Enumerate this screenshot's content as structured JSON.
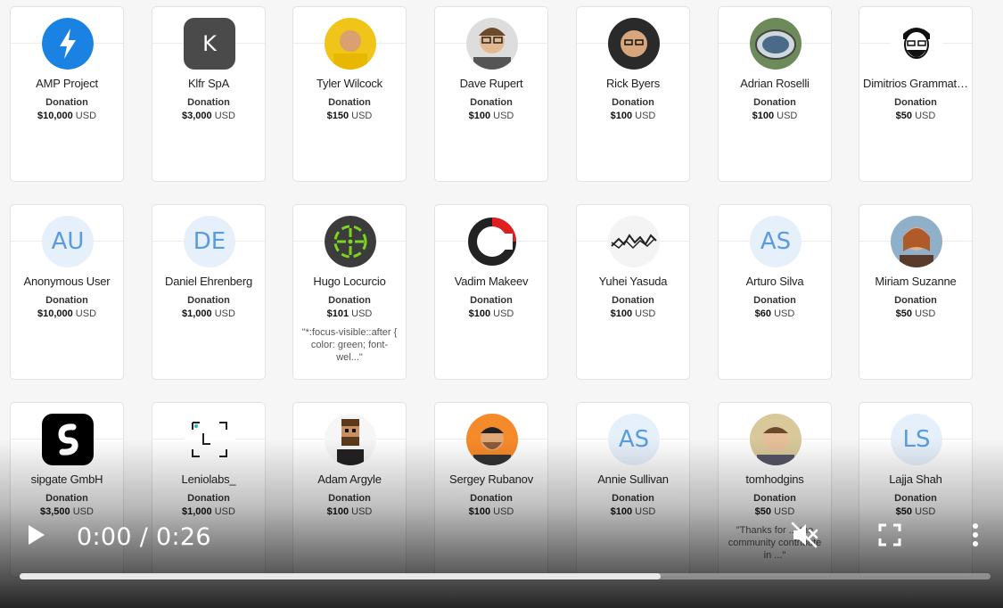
{
  "cards": [
    {
      "name": "AMP Project",
      "kind": "Donation",
      "amount": "$10,000",
      "currency": "USD",
      "avatar": "lightning-icon",
      "comment": ""
    },
    {
      "name": "Klfr SpA",
      "kind": "Donation",
      "amount": "$3,000",
      "currency": "USD",
      "avatar": "initial",
      "initials": "K",
      "comment": ""
    },
    {
      "name": "Tyler Wilcock",
      "kind": "Donation",
      "amount": "$150",
      "currency": "USD",
      "avatar": "photo",
      "comment": ""
    },
    {
      "name": "Dave Rupert",
      "kind": "Donation",
      "amount": "$100",
      "currency": "USD",
      "avatar": "photo",
      "comment": ""
    },
    {
      "name": "Rick Byers",
      "kind": "Donation",
      "amount": "$100",
      "currency": "USD",
      "avatar": "photo",
      "comment": ""
    },
    {
      "name": "Adrian Roselli",
      "kind": "Donation",
      "amount": "$100",
      "currency": "USD",
      "avatar": "photo",
      "comment": ""
    },
    {
      "name": "Dimitrios Grammatikogiannis",
      "kind": "Donation",
      "amount": "$50",
      "currency": "USD",
      "avatar": "illustration",
      "comment": ""
    },
    {
      "name": "Anonymous User",
      "kind": "Donation",
      "amount": "$10,000",
      "currency": "USD",
      "avatar": "initials",
      "initials": "AU",
      "comment": ""
    },
    {
      "name": "Daniel Ehrenberg",
      "kind": "Donation",
      "amount": "$1,000",
      "currency": "USD",
      "avatar": "initials",
      "initials": "DE",
      "comment": ""
    },
    {
      "name": "Hugo Locurcio",
      "kind": "Donation",
      "amount": "$101",
      "currency": "USD",
      "avatar": "crosshair-icon",
      "comment": "\"*:focus-visible::after { color: green; font-wel...\""
    },
    {
      "name": "Vadim Makeev",
      "kind": "Donation",
      "amount": "$100",
      "currency": "USD",
      "avatar": "logo",
      "comment": ""
    },
    {
      "name": "Yuhei Yasuda",
      "kind": "Donation",
      "amount": "$100",
      "currency": "USD",
      "avatar": "logo",
      "comment": ""
    },
    {
      "name": "Arturo Silva",
      "kind": "Donation",
      "amount": "$60",
      "currency": "USD",
      "avatar": "initials",
      "initials": "AS",
      "comment": ""
    },
    {
      "name": "Miriam Suzanne",
      "kind": "Donation",
      "amount": "$50",
      "currency": "USD",
      "avatar": "photo",
      "comment": ""
    },
    {
      "name": "sipgate GmbH",
      "kind": "Donation",
      "amount": "$3,500",
      "currency": "USD",
      "avatar": "logo",
      "comment": ""
    },
    {
      "name": "Leniolabs_",
      "kind": "Donation",
      "amount": "$1,000",
      "currency": "USD",
      "avatar": "logo",
      "comment": ""
    },
    {
      "name": "Adam Argyle",
      "kind": "Donation",
      "amount": "$100",
      "currency": "USD",
      "avatar": "illustration",
      "comment": ""
    },
    {
      "name": "Sergey Rubanov",
      "kind": "Donation",
      "amount": "$100",
      "currency": "USD",
      "avatar": "photo",
      "comment": ""
    },
    {
      "name": "Annie Sullivan",
      "kind": "Donation",
      "amount": "$100",
      "currency": "USD",
      "avatar": "initials",
      "initials": "AS",
      "comment": ""
    },
    {
      "name": "tomhodgins",
      "kind": "Donation",
      "amount": "$50",
      "currency": "USD",
      "avatar": "photo",
      "comment": "\"Thanks for ... the community contribute in ...\""
    },
    {
      "name": "Lajja Shah",
      "kind": "Donation",
      "amount": "$50",
      "currency": "USD",
      "avatar": "initials",
      "initials": "LS",
      "comment": ""
    }
  ],
  "player": {
    "current_time": "0:00",
    "duration": "0:26",
    "time_display": "0:00 / 0:26",
    "progress_fraction": 0.0,
    "buffered_fraction": 0.66,
    "muted": true
  },
  "colors": {
    "amp": "#1a82e2",
    "initials_bg": "#e6f0fb",
    "initials_fg": "#5a9be0"
  }
}
